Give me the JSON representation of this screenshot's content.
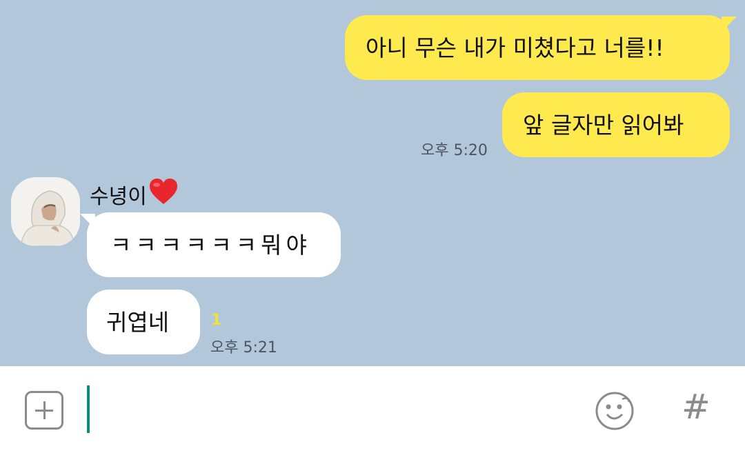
{
  "messages": [
    {
      "side": "me",
      "text": "아니 무슨 내가 미쳤다고 너를!!"
    },
    {
      "side": "me",
      "text": "앞 글자만 읽어봐",
      "time": "오후 5:20"
    },
    {
      "side": "other",
      "text": "ㅋㅋㅋㅋㅋㅋ뭐야"
    },
    {
      "side": "other",
      "text": "귀엽네",
      "time": "오후 5:21",
      "unread": "1"
    }
  ],
  "sender": {
    "name": "수녕이",
    "icon": "heart-icon"
  },
  "input": {
    "value": "",
    "placeholder": ""
  },
  "icons": {
    "attach": "plus-square-icon",
    "emoji": "smiley-icon",
    "hashtag": "hash-icon",
    "hash_glyph": "#"
  },
  "colors": {
    "background": "#b2c7da",
    "my_bubble": "#fee94f",
    "their_bubble": "#ffffff",
    "cursor": "#0e8c7a",
    "unread": "#f2df3a"
  }
}
